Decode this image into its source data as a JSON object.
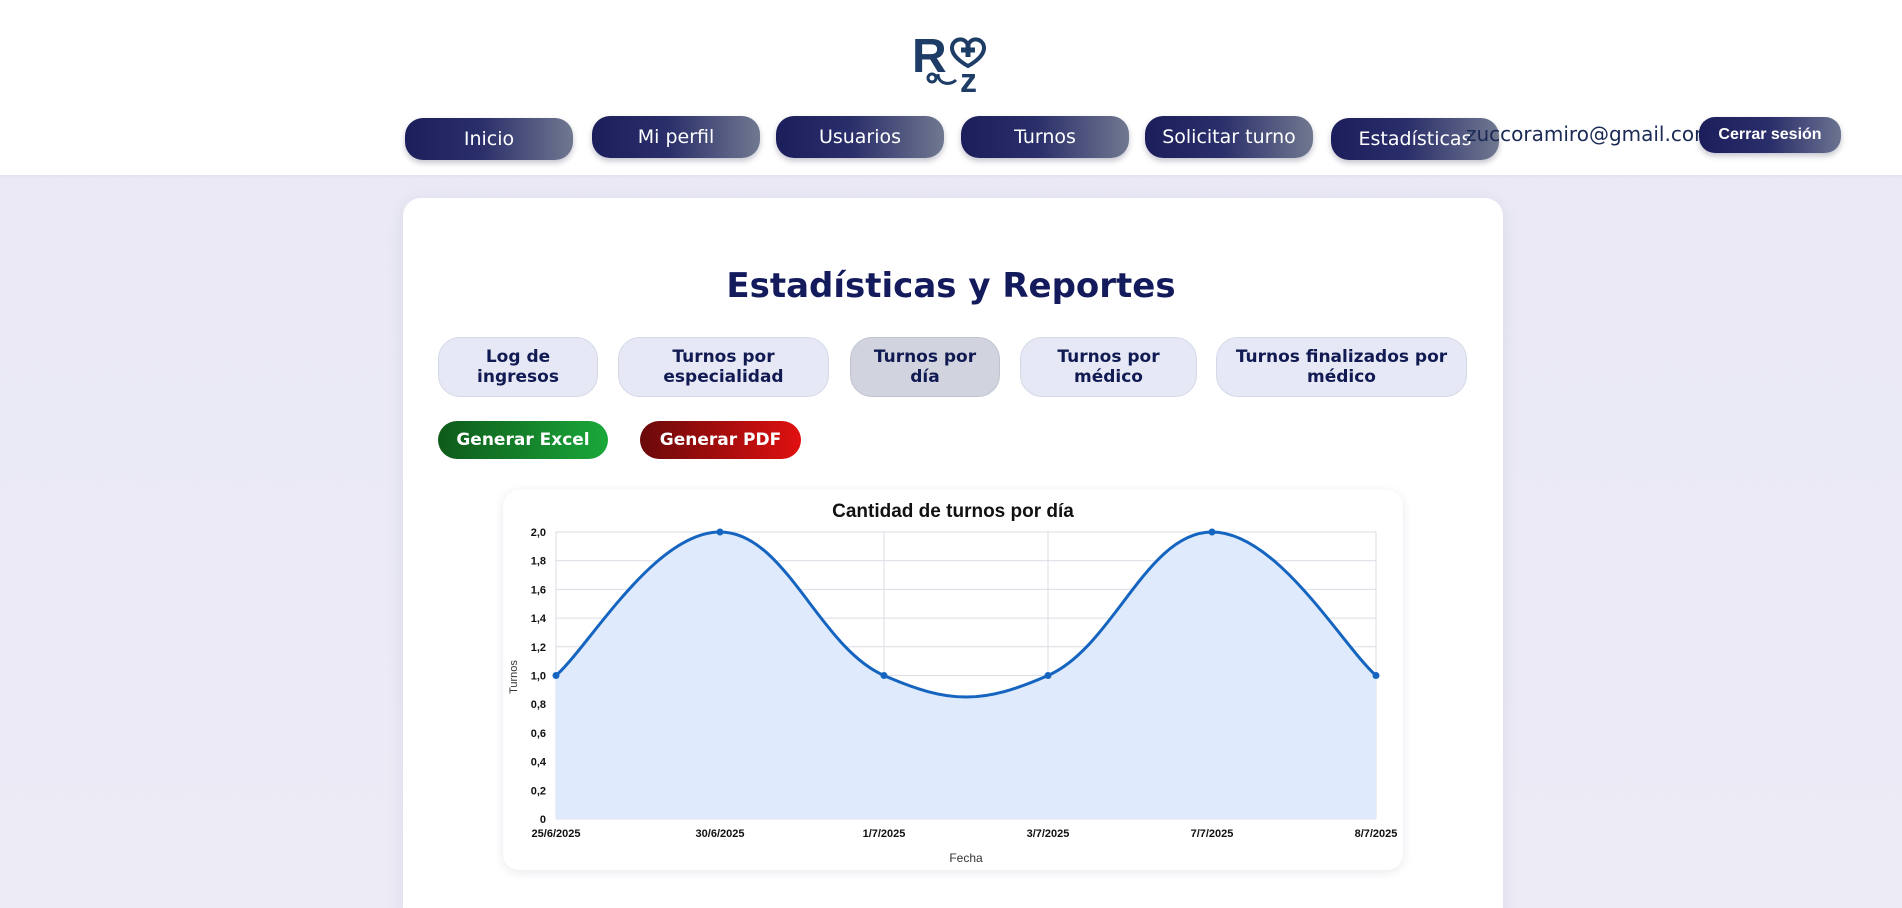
{
  "header": {
    "logo_alt": "RZ",
    "nav": [
      {
        "label": "Inicio"
      },
      {
        "label": "Mi perfil"
      },
      {
        "label": "Usuarios"
      },
      {
        "label": "Turnos"
      },
      {
        "label": "Solicitar turno"
      },
      {
        "label": "Estadísticas"
      }
    ],
    "email": "zuccoramiro@gmail.com",
    "logout_label": "Cerrar sesión"
  },
  "main": {
    "title": "Estadísticas y Reportes",
    "tabs": [
      {
        "label_line1": "Log de",
        "label_line2": "ingresos",
        "active": false
      },
      {
        "label_line1": "Turnos por",
        "label_line2": "especialidad",
        "active": false
      },
      {
        "label_line1": "Turnos por",
        "label_line2": "día",
        "active": true
      },
      {
        "label_line1": "Turnos por",
        "label_line2": "médico",
        "active": false
      },
      {
        "label_line1": "Turnos finalizados por",
        "label_line2": "médico",
        "active": false
      }
    ],
    "actions": {
      "excel_label": "Generar Excel",
      "pdf_label": "Generar PDF"
    }
  },
  "colors": {
    "nav_dark": "#1b1e5a",
    "title": "#141b5c",
    "line": "#1565c0",
    "fill": "#dfeafc",
    "excel": "#1aa83a",
    "pdf": "#e01010"
  },
  "chart_data": {
    "type": "line",
    "title": "Cantidad de turnos por día",
    "xlabel": "Fecha",
    "ylabel": "Turnos",
    "categories": [
      "25/6/2025",
      "30/6/2025",
      "1/7/2025",
      "3/7/2025",
      "7/7/2025",
      "8/7/2025"
    ],
    "series": [
      {
        "values": [
          1,
          2,
          1,
          1,
          2,
          1
        ]
      }
    ],
    "ylim": [
      0,
      2
    ],
    "yticks": [
      "0",
      "0,2",
      "0,4",
      "0,6",
      "0,8",
      "1,0",
      "1,2",
      "1,4",
      "1,6",
      "1,8",
      "2,0"
    ],
    "fill": true,
    "smooth": true,
    "grid": true
  }
}
